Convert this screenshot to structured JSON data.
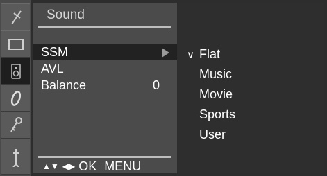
{
  "menu": {
    "title": "Sound",
    "items": [
      {
        "label": "SSM",
        "value": ""
      },
      {
        "label": "AVL",
        "value": ""
      },
      {
        "label": "Balance",
        "value": "0"
      }
    ],
    "footer": {
      "updown": "▲▼",
      "leftright": "◀▶",
      "ok": "OK",
      "menu": "MENU"
    }
  },
  "submenu": {
    "check_mark": "∨",
    "options": [
      "Flat",
      "Music",
      "Movie",
      "Sports",
      "User"
    ],
    "selected": "Flat"
  },
  "icons": [
    "antenna-icon",
    "picture-icon",
    "speaker-icon",
    "clock-icon",
    "key-icon",
    "input-plug-icon"
  ]
}
